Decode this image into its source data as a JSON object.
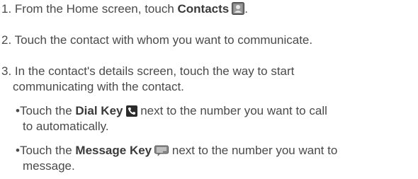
{
  "steps": [
    {
      "number": "1.",
      "prefix": "From the Home screen, touch ",
      "bold": "Contacts",
      "suffix": ".",
      "icon": "contacts-icon"
    },
    {
      "number": "2.",
      "text": "Touch the contact with whom you want to communicate."
    },
    {
      "number": "3.",
      "line1": "In the contact's details screen, touch the way to start",
      "line2": "communicating with the contact."
    }
  ],
  "bullets": [
    {
      "symbol": "•",
      "prefix": "Touch the ",
      "bold": "Dial Key",
      "after_icon": " next to the number you want to call",
      "line2": "to automatically.",
      "icon": "phone-icon"
    },
    {
      "symbol": "•",
      "prefix": "Touch the ",
      "bold": "Message Key",
      "after_icon": " next to the number you want to",
      "line2": "message.",
      "icon": "message-icon"
    }
  ],
  "colors": {
    "text": "#4a4a4a",
    "icon_dark": "#2b2b2b"
  }
}
